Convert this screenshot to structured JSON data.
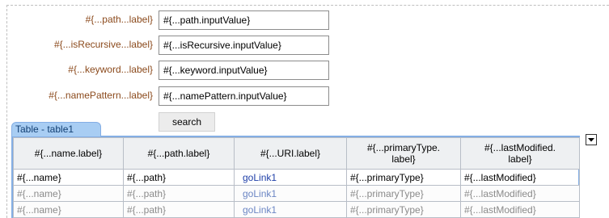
{
  "form": {
    "fields": [
      {
        "label": "#{...path...label}",
        "value": "#{...path.inputValue}"
      },
      {
        "label": "#{...isRecursive...label}",
        "value": "#{...isRecursive.inputValue}"
      },
      {
        "label": "#{...keyword...label}",
        "value": "#{...keyword.inputValue}"
      },
      {
        "label": "#{...namePattern...label}",
        "value": "#{...namePattern.inputValue}"
      }
    ],
    "search_label": "search"
  },
  "table": {
    "tab_label": "Table - table1",
    "columns": [
      {
        "label": "#{...name.label}"
      },
      {
        "label": "#{...path.label}"
      },
      {
        "label": "#{...URI.label}"
      },
      {
        "label": "#{...primaryType.\nlabel}"
      },
      {
        "label": "#{...lastModified.\nlabel}"
      }
    ],
    "rows": [
      [
        "#{...name}",
        "#{...path}",
        "goLink1",
        "#{...primaryType}",
        "#{...lastModified}"
      ],
      [
        "#{...name}",
        "#{...path}",
        "goLink1",
        "#{...primaryType}",
        "#{...lastModified}"
      ],
      [
        "#{...name}",
        "#{...path}",
        "goLink1",
        "#{...primaryType}",
        "#{...lastModified}"
      ]
    ]
  },
  "icons": {
    "table_menu": "chevron-down-icon"
  },
  "colors": {
    "label_text": "#8b4a1c",
    "tab_background": "#a8cdf3",
    "table_border": "#84aee4",
    "link_text": "#1f3fa8"
  }
}
